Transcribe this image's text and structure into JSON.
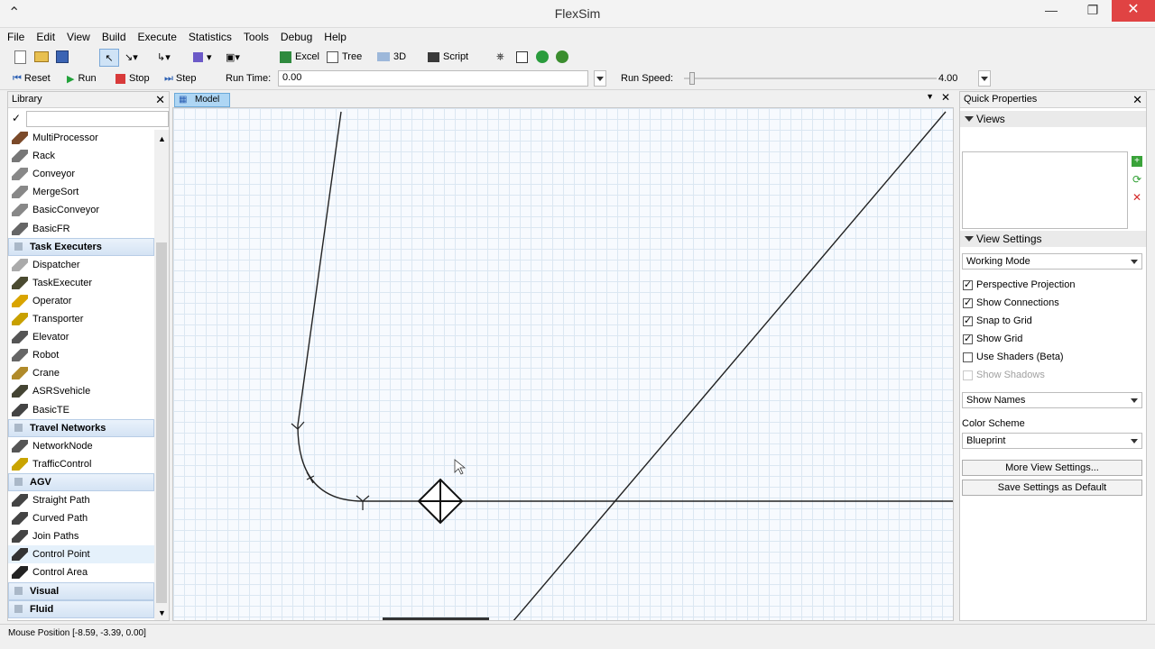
{
  "window": {
    "title": "FlexSim"
  },
  "menu": [
    "File",
    "Edit",
    "View",
    "Build",
    "Execute",
    "Statistics",
    "Tools",
    "Debug",
    "Help"
  ],
  "toolbar": {
    "excel": "Excel",
    "tree": "Tree",
    "threed": "3D",
    "script": "Script"
  },
  "run_controls": {
    "reset": "Reset",
    "run": "Run",
    "stop": "Stop",
    "step": "Step",
    "run_time_label": "Run Time:",
    "run_time_value": "0.00",
    "run_speed_label": "Run Speed:",
    "run_speed_value": "4.00",
    "run_speed_fraction": 0.02
  },
  "library": {
    "title": "Library",
    "items": [
      {
        "label": "MultiProcessor",
        "type": "item",
        "icon": "multiprocessor-icon"
      },
      {
        "label": "Rack",
        "type": "item",
        "icon": "rack-icon"
      },
      {
        "label": "Conveyor",
        "type": "item",
        "icon": "conveyor-icon"
      },
      {
        "label": "MergeSort",
        "type": "item",
        "icon": "mergesort-icon"
      },
      {
        "label": "BasicConveyor",
        "type": "item",
        "icon": "basic-conveyor-icon"
      },
      {
        "label": "BasicFR",
        "type": "item",
        "icon": "basicfr-icon"
      },
      {
        "label": "Task Executers",
        "type": "group"
      },
      {
        "label": "Dispatcher",
        "type": "item",
        "icon": "dispatcher-icon"
      },
      {
        "label": "TaskExecuter",
        "type": "item",
        "icon": "taskexecuter-icon"
      },
      {
        "label": "Operator",
        "type": "item",
        "icon": "operator-icon"
      },
      {
        "label": "Transporter",
        "type": "item",
        "icon": "transporter-icon"
      },
      {
        "label": "Elevator",
        "type": "item",
        "icon": "elevator-icon"
      },
      {
        "label": "Robot",
        "type": "item",
        "icon": "robot-icon"
      },
      {
        "label": "Crane",
        "type": "item",
        "icon": "crane-icon"
      },
      {
        "label": "ASRSvehicle",
        "type": "item",
        "icon": "asrs-vehicle-icon"
      },
      {
        "label": "BasicTE",
        "type": "item",
        "icon": "basicte-icon"
      },
      {
        "label": "Travel Networks",
        "type": "group"
      },
      {
        "label": "NetworkNode",
        "type": "item",
        "icon": "network-node-icon"
      },
      {
        "label": "TrafficControl",
        "type": "item",
        "icon": "traffic-control-icon"
      },
      {
        "label": "AGV",
        "type": "group"
      },
      {
        "label": "Straight Path",
        "type": "item",
        "icon": "straight-path-icon"
      },
      {
        "label": "Curved Path",
        "type": "item",
        "icon": "curved-path-icon"
      },
      {
        "label": "Join Paths",
        "type": "item",
        "icon": "join-paths-icon"
      },
      {
        "label": "Control Point",
        "type": "item",
        "icon": "control-point-icon",
        "selected": true
      },
      {
        "label": "Control Area",
        "type": "item",
        "icon": "control-area-icon"
      },
      {
        "label": "Visual",
        "type": "group"
      },
      {
        "label": "Fluid",
        "type": "group"
      }
    ]
  },
  "model": {
    "tab_label": "Model"
  },
  "quick_properties": {
    "title": "Quick Properties",
    "views_header": "Views",
    "view_settings_header": "View Settings",
    "mode": "Working Mode",
    "checkboxes": [
      {
        "label": "Perspective Projection",
        "checked": true,
        "disabled": false
      },
      {
        "label": "Show Connections",
        "checked": true,
        "disabled": false
      },
      {
        "label": "Snap to Grid",
        "checked": true,
        "disabled": false
      },
      {
        "label": "Show Grid",
        "checked": true,
        "disabled": false
      },
      {
        "label": "Use Shaders (Beta)",
        "checked": false,
        "disabled": false
      },
      {
        "label": "Show Shadows",
        "checked": false,
        "disabled": true
      }
    ],
    "names": "Show Names",
    "color_scheme_label": "Color Scheme",
    "color_scheme": "Blueprint",
    "more_settings": "More View Settings...",
    "save_default": "Save Settings as Default"
  },
  "status": {
    "mouse_position": "Mouse Position [-8.59, -3.39, 0.00]"
  },
  "colors": {
    "accent": "#aed6f4",
    "close": "#e04343",
    "grid": "#dbe7f2"
  }
}
